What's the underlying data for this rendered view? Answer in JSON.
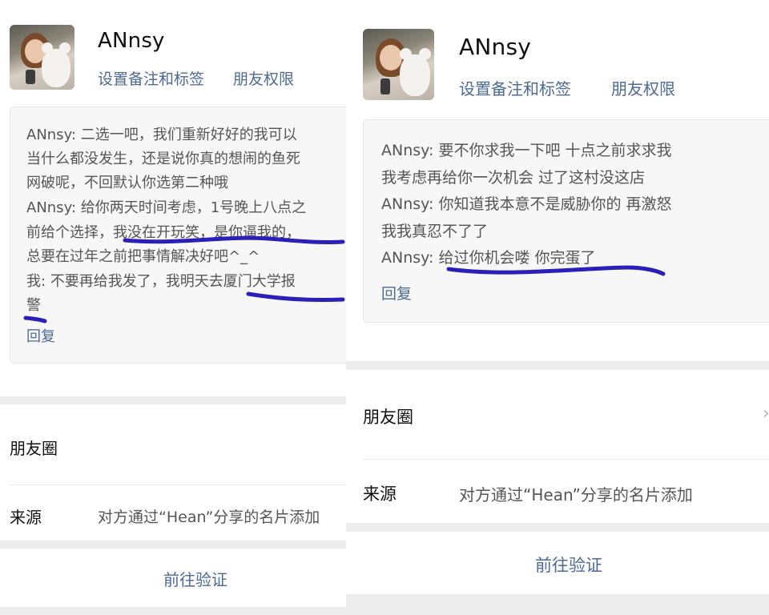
{
  "left": {
    "contact_name": "ANnsy",
    "set_remark_label": "设置备注和标签",
    "friend_permission_label": "朋友权限",
    "messages": [
      "ANnsy: 二选一吧，我们重新好好的我可以",
      "当什么都没发生，还是说你真的想闹的鱼死",
      "网破呢，不回默认你选第二种哦",
      "ANnsy: 给你两天时间考虑，1号晚上八点之",
      "前给个选择，我没在开玩笑，是你逼我的，",
      "总要在过年之前把事情解决好吧^_^",
      "我: 不要再给我发了，我明天去厦门大学报",
      "警"
    ],
    "reply_label": "回复",
    "moments_label": "朋友圈",
    "source_label": "来源",
    "source_value": "对方通过“Hean”分享的名片添加",
    "verify_button": "前往验证"
  },
  "right": {
    "contact_name": "ANnsy",
    "set_remark_label": "设置备注和标签",
    "friend_permission_label": "朋友权限",
    "messages": [
      "ANnsy: 要不你求我一下吧 十点之前求求我",
      "我考虑再给你一次机会 过了这村没这店",
      "ANnsy: 你知道我本意不是威胁你的 再激怒",
      "我我真忍不了了",
      "ANnsy: 给过你机会喽 你完蛋了"
    ],
    "reply_label": "回复",
    "moments_label": "朋友圈",
    "source_label": "来源",
    "source_value": "对方通过“Hean”分享的名片添加",
    "verify_button": "前往验证",
    "chevron_icon": "chevron-right-icon"
  },
  "colors": {
    "link": "#4c6a93",
    "scribble": "#2a1fb8",
    "separator": "#ededed",
    "message_bg": "#f7f7f7"
  }
}
